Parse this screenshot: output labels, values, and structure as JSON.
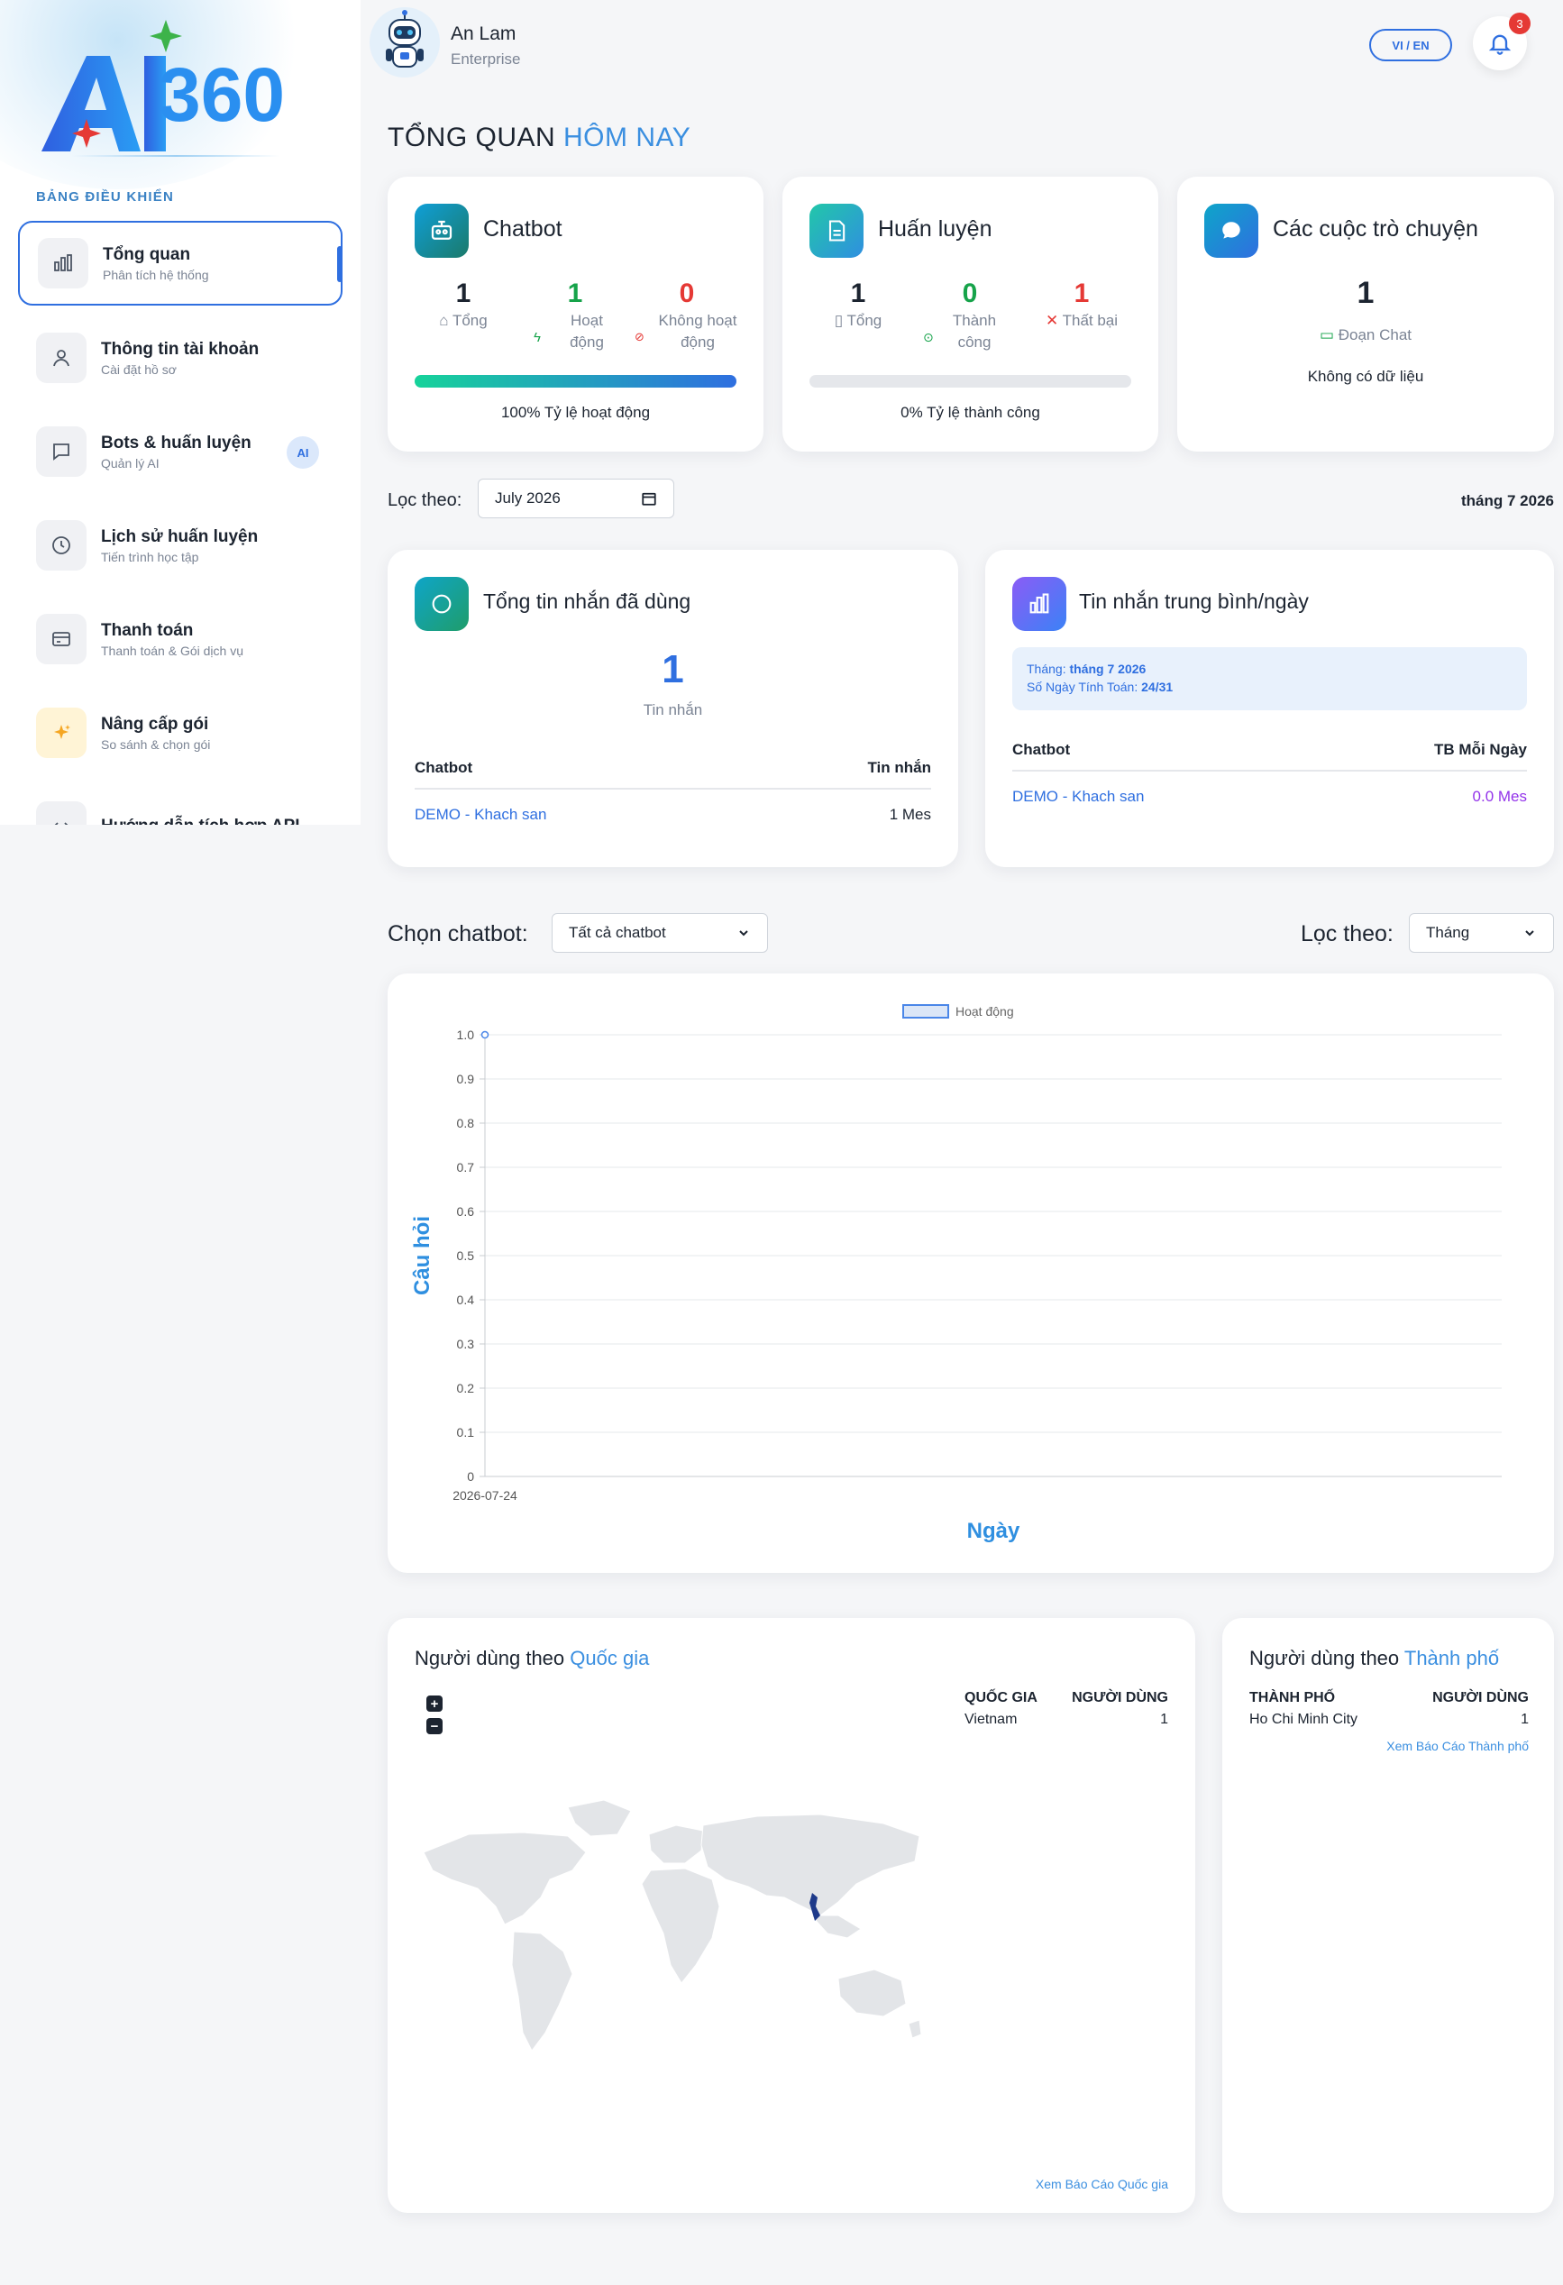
{
  "brand": {
    "logo_text": "AI360",
    "accent": "#2f6fe0"
  },
  "sidebar": {
    "heading": "BẢNG ĐIỀU KHIỂN",
    "items": [
      {
        "label": "Tổng quan",
        "sub": "Phân tích hệ thống",
        "icon": "bar-chart-icon",
        "active": true
      },
      {
        "label": "Thông tin tài khoản",
        "sub": "Cài đặt hồ sơ",
        "icon": "user-icon"
      },
      {
        "label": "Bots & huấn luyện",
        "sub": "Quản lý AI",
        "icon": "chat-icon",
        "badge": "AI"
      },
      {
        "label": "Lịch sử huấn luyện",
        "sub": "Tiến trình học tập",
        "icon": "clock-icon"
      },
      {
        "label": "Thanh toán",
        "sub": "Thanh toán & Gói dịch vụ",
        "icon": "credit-card-icon"
      },
      {
        "label": "Nâng cấp gói",
        "sub": "So sánh & chọn gói",
        "icon": "sparkle-icon"
      },
      {
        "label": "Hướng dẫn tích hợp API",
        "sub": "",
        "icon": "code-icon"
      }
    ]
  },
  "header": {
    "user_name": "An Lam",
    "user_role": "Enterprise",
    "lang": "VI / EN",
    "notifications": "3"
  },
  "page": {
    "title_main": "TỔNG QUAN ",
    "title_highlight": "HÔM NAY"
  },
  "cards": {
    "chatbot": {
      "title": "Chatbot",
      "stats": [
        {
          "value": "1",
          "label": "Tổng"
        },
        {
          "value": "1",
          "label": "Hoạt động"
        },
        {
          "value": "0",
          "label": "Không hoạt động"
        }
      ],
      "progress": 1.0,
      "caption": "100% Tỷ lệ hoạt động"
    },
    "training": {
      "title": "Huấn luyện",
      "stats": [
        {
          "value": "1",
          "label": "Tổng"
        },
        {
          "value": "0",
          "label": "Thành công"
        },
        {
          "value": "1",
          "label": "Thất bại"
        }
      ],
      "progress": 0.0,
      "caption": "0% Tỷ lệ thành công"
    },
    "conversations": {
      "title": "Các cuộc trò chuyện",
      "value": "1",
      "label": "Đoạn Chat",
      "empty": "Không có dữ liệu"
    }
  },
  "filter": {
    "label": "Lọc theo:",
    "month_value": "July 2026",
    "month_display": "tháng 7 2026"
  },
  "messages_used": {
    "title": "Tổng tin nhắn đã dùng",
    "value": "1",
    "unit": "Tin nhắn",
    "col_chatbot": "Chatbot",
    "col_messages": "Tin nhắn",
    "rows": [
      {
        "chatbot": "DEMO - Khach san",
        "value": "1 Mes"
      }
    ]
  },
  "avg_messages": {
    "title": "Tin nhắn trung bình/ngày",
    "month_label": "Tháng: ",
    "month_value": "tháng 7 2026",
    "days_label": "Số Ngày Tính Toán: ",
    "days_value": "24/31",
    "col_chatbot": "Chatbot",
    "col_avg": "TB Mỗi Ngày",
    "rows": [
      {
        "chatbot": "DEMO - Khach san",
        "value": "0.0 Mes"
      }
    ]
  },
  "chart_controls": {
    "choose_label": "Chọn chatbot:",
    "choose_value": "Tất cả chatbot",
    "filter_label": "Lọc theo:",
    "filter_value": "Tháng"
  },
  "chart_data": {
    "type": "line",
    "title": "",
    "x": [
      "2026-07-24"
    ],
    "series": [
      {
        "name": "Hoạt động",
        "values": [
          1.0
        ],
        "color": "#4a86e8"
      }
    ],
    "xlabel": "Ngày",
    "ylabel": "Câu hỏi",
    "ylim": [
      0,
      1.0
    ],
    "yticks": [
      "0",
      "0.1",
      "0.2",
      "0.3",
      "0.4",
      "0.5",
      "0.6",
      "0.7",
      "0.8",
      "0.9",
      "1.0"
    ],
    "grid": true,
    "legend": "top"
  },
  "users_country": {
    "title": "Người dùng theo ",
    "title_hl": "Quốc gia",
    "col_country": "QUỐC GIA",
    "col_users": "NGƯỜI DÙNG",
    "rows": [
      {
        "name": "Vietnam",
        "users": "1"
      }
    ],
    "link": "Xem Báo Cáo Quốc gia",
    "zoom_in": "+",
    "zoom_out": "−"
  },
  "users_city": {
    "title": "Người dùng theo ",
    "title_hl": "Thành phố",
    "col_city": "THÀNH PHỐ",
    "col_users": "NGƯỜI DÙNG",
    "rows": [
      {
        "name": "Ho Chi Minh City",
        "users": "1"
      }
    ],
    "link": "Xem Báo Cáo Thành phố"
  }
}
